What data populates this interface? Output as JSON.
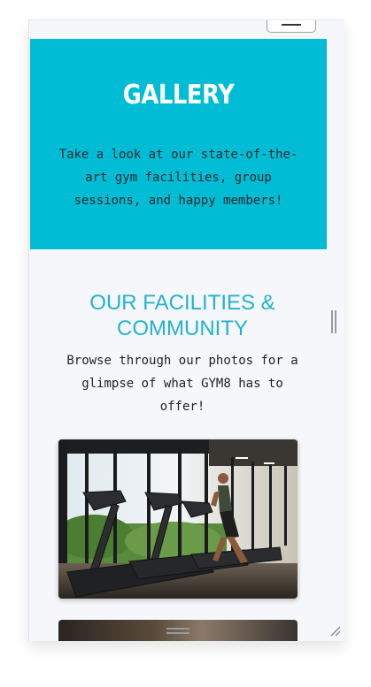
{
  "hero": {
    "title": "GALLERY",
    "text": "Take a look at our state-of-the-art gym facilities, group sessions, and happy members!"
  },
  "section": {
    "title": "OUR FACILITIES & COMMUNITY",
    "text": "Browse through our photos for a glimpse of what GYM8 has to offer!"
  },
  "gallery": [
    {
      "caption": ""
    }
  ],
  "colors": {
    "hero_bg": "#00bcd4",
    "accent": "#21b3cf",
    "page_bg": "#f6f7fa"
  },
  "icons": {
    "menu": "hamburger-menu-icon",
    "resize": "resize-grip-icon"
  }
}
